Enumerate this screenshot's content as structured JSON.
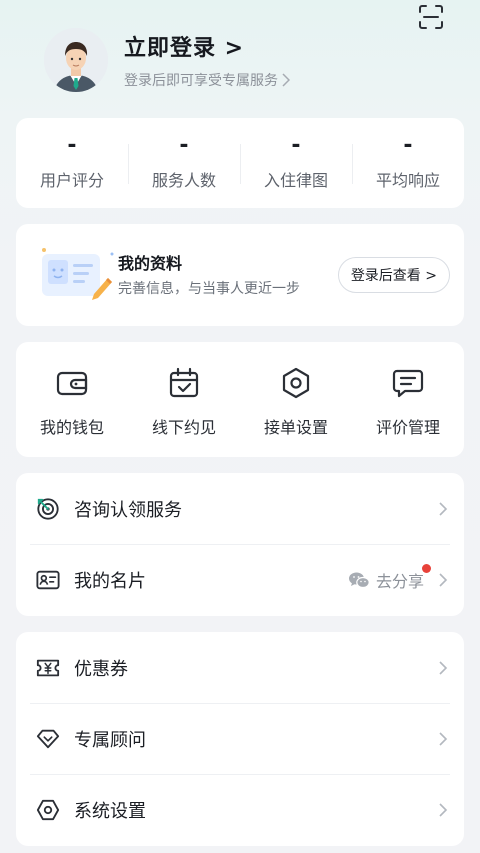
{
  "header": {
    "login_title": "立即登录 >",
    "login_subtitle": "登录后即可享受专属服务"
  },
  "stats": [
    {
      "value": "-",
      "label": "用户评分"
    },
    {
      "value": "-",
      "label": "服务人数"
    },
    {
      "value": "-",
      "label": "入住律图"
    },
    {
      "value": "-",
      "label": "平均响应"
    }
  ],
  "profile": {
    "title": "我的资料",
    "subtitle": "完善信息，与当事人更近一步",
    "button_label": "登录后查看 >"
  },
  "tools": [
    {
      "label": "我的钱包",
      "icon": "wallet-icon"
    },
    {
      "label": "线下约见",
      "icon": "calendar-check-icon"
    },
    {
      "label": "接单设置",
      "icon": "hexagon-settings-icon"
    },
    {
      "label": "评价管理",
      "icon": "comment-icon"
    }
  ],
  "list1": [
    {
      "label": "咨询认领服务",
      "icon": "target-icon"
    },
    {
      "label": "我的名片",
      "icon": "id-card-icon",
      "share_label": "去分享",
      "share_icon": "wechat-icon"
    }
  ],
  "list2": [
    {
      "label": "优惠券",
      "icon": "coupon-icon"
    },
    {
      "label": "专属顾问",
      "icon": "diamond-icon"
    },
    {
      "label": "系统设置",
      "icon": "settings-icon"
    }
  ],
  "colors": {
    "accent_red": "#e8423a",
    "background": "#f2f3f6",
    "card": "#ffffff"
  }
}
